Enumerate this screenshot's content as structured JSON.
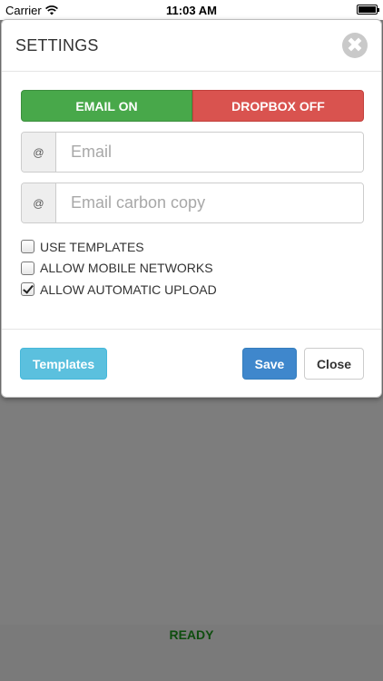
{
  "status_bar": {
    "carrier": "Carrier",
    "time": "11:03 AM"
  },
  "modal": {
    "title": "SETTINGS",
    "toggles": {
      "email": "EMAIL ON",
      "dropbox": "DROPBOX OFF"
    },
    "fields": {
      "email": {
        "addon": "@",
        "placeholder": "Email",
        "value": ""
      },
      "email_cc": {
        "addon": "@",
        "placeholder": "Email carbon copy",
        "value": ""
      }
    },
    "checkboxes": [
      {
        "label": "USE TEMPLATES",
        "checked": false
      },
      {
        "label": "ALLOW MOBILE NETWORKS",
        "checked": false
      },
      {
        "label": "ALLOW AUTOMATIC UPLOAD",
        "checked": true
      }
    ],
    "footer": {
      "templates_label": "Templates",
      "save_label": "Save",
      "close_label": "Close"
    }
  },
  "status": {
    "text": "READY"
  },
  "colors": {
    "email_on": "#48a84a",
    "dropbox_off": "#d9534f",
    "templates_btn": "#5bc0de",
    "save_btn": "#3f87cc",
    "ready_text": "#0e4d0e",
    "backdrop": "#7d7d7d"
  }
}
